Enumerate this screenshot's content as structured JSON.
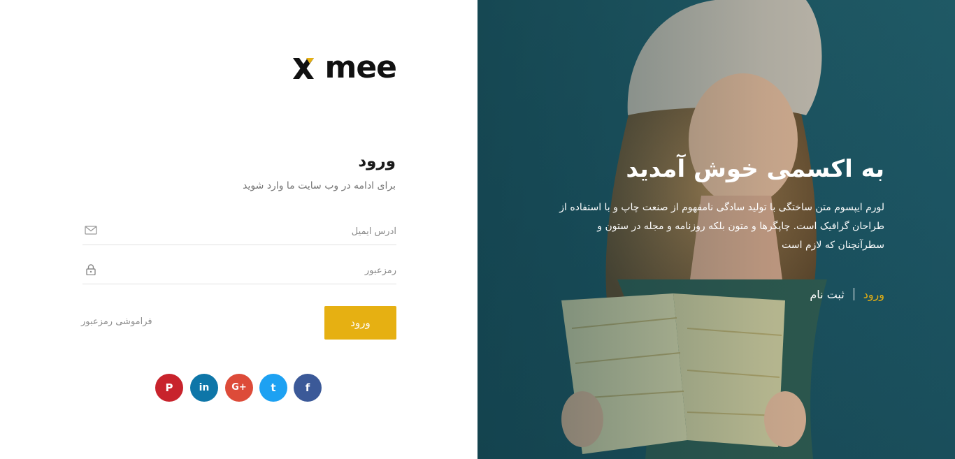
{
  "brand": {
    "logo_text": "mee",
    "accent": "#e6b012"
  },
  "form": {
    "title": "ورود",
    "subtitle": "برای ادامه در وب سایت ما وارد شوید",
    "email_placeholder": "آدرس ایمیل",
    "password_placeholder": "رمزعبور",
    "login_button": "ورود",
    "forgot_link": "فراموشی رمزعبور"
  },
  "socials": [
    {
      "name": "pinterest",
      "glyph": "P",
      "color": "#c8232c"
    },
    {
      "name": "linkedin",
      "glyph": "in",
      "color": "#0e76a8"
    },
    {
      "name": "google-plus",
      "glyph": "G+",
      "color": "#dd4b39"
    },
    {
      "name": "twitter",
      "glyph": "t",
      "color": "#1da1f2"
    },
    {
      "name": "facebook",
      "glyph": "f",
      "color": "#3b5998"
    }
  ],
  "hero": {
    "title": "به اکسمی خوش آمدید",
    "text": "لورم ایپسوم متن ساختگی با تولید سادگی نامفهوم از صنعت چاپ و با استفاده از طراحان گرافیک است. چاپگرها و متون بلکه روزنامه و مجله در ستون و سطرآنچنان که لازم است",
    "link_login": "ورود",
    "link_register": "ثبت نام"
  }
}
